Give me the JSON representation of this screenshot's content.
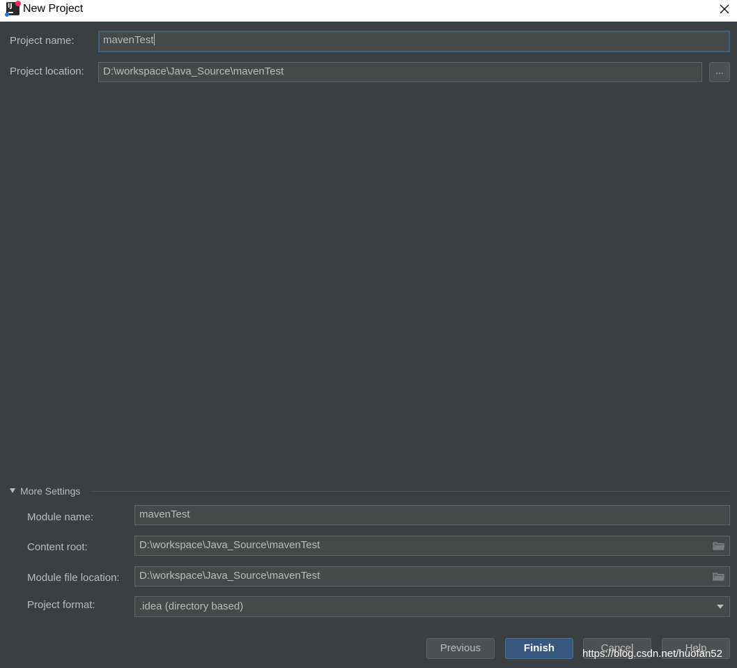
{
  "window": {
    "title": "New Project",
    "app_icon": "intellij-idea-icon",
    "close_icon": "close-icon"
  },
  "project": {
    "name_label": "Project name:",
    "name_value": "mavenTest",
    "location_label": "Project location:",
    "location_value": "D:\\workspace\\Java_Source\\mavenTest",
    "browse_label": "..."
  },
  "more_settings": {
    "header": "More Settings",
    "expanded": true,
    "module_name_label": "Module name:",
    "module_name_value": "mavenTest",
    "content_root_label": "Content root:",
    "content_root_value": "D:\\workspace\\Java_Source\\mavenTest",
    "module_file_location_label": "Module file location:",
    "module_file_location_value": "D:\\workspace\\Java_Source\\mavenTest",
    "project_format_label": "Project format:",
    "project_format_value": ".idea (directory based)"
  },
  "buttons": {
    "previous": "Previous",
    "finish": "Finish",
    "cancel": "Cancel",
    "help": "Help"
  },
  "watermark": "https://blog.csdn.net/huofan52",
  "colors": {
    "background": "#3c3f41",
    "field_background": "#45494a",
    "primary_button": "#365880",
    "focus_border": "#3d6185",
    "text": "#bbbbbb"
  }
}
